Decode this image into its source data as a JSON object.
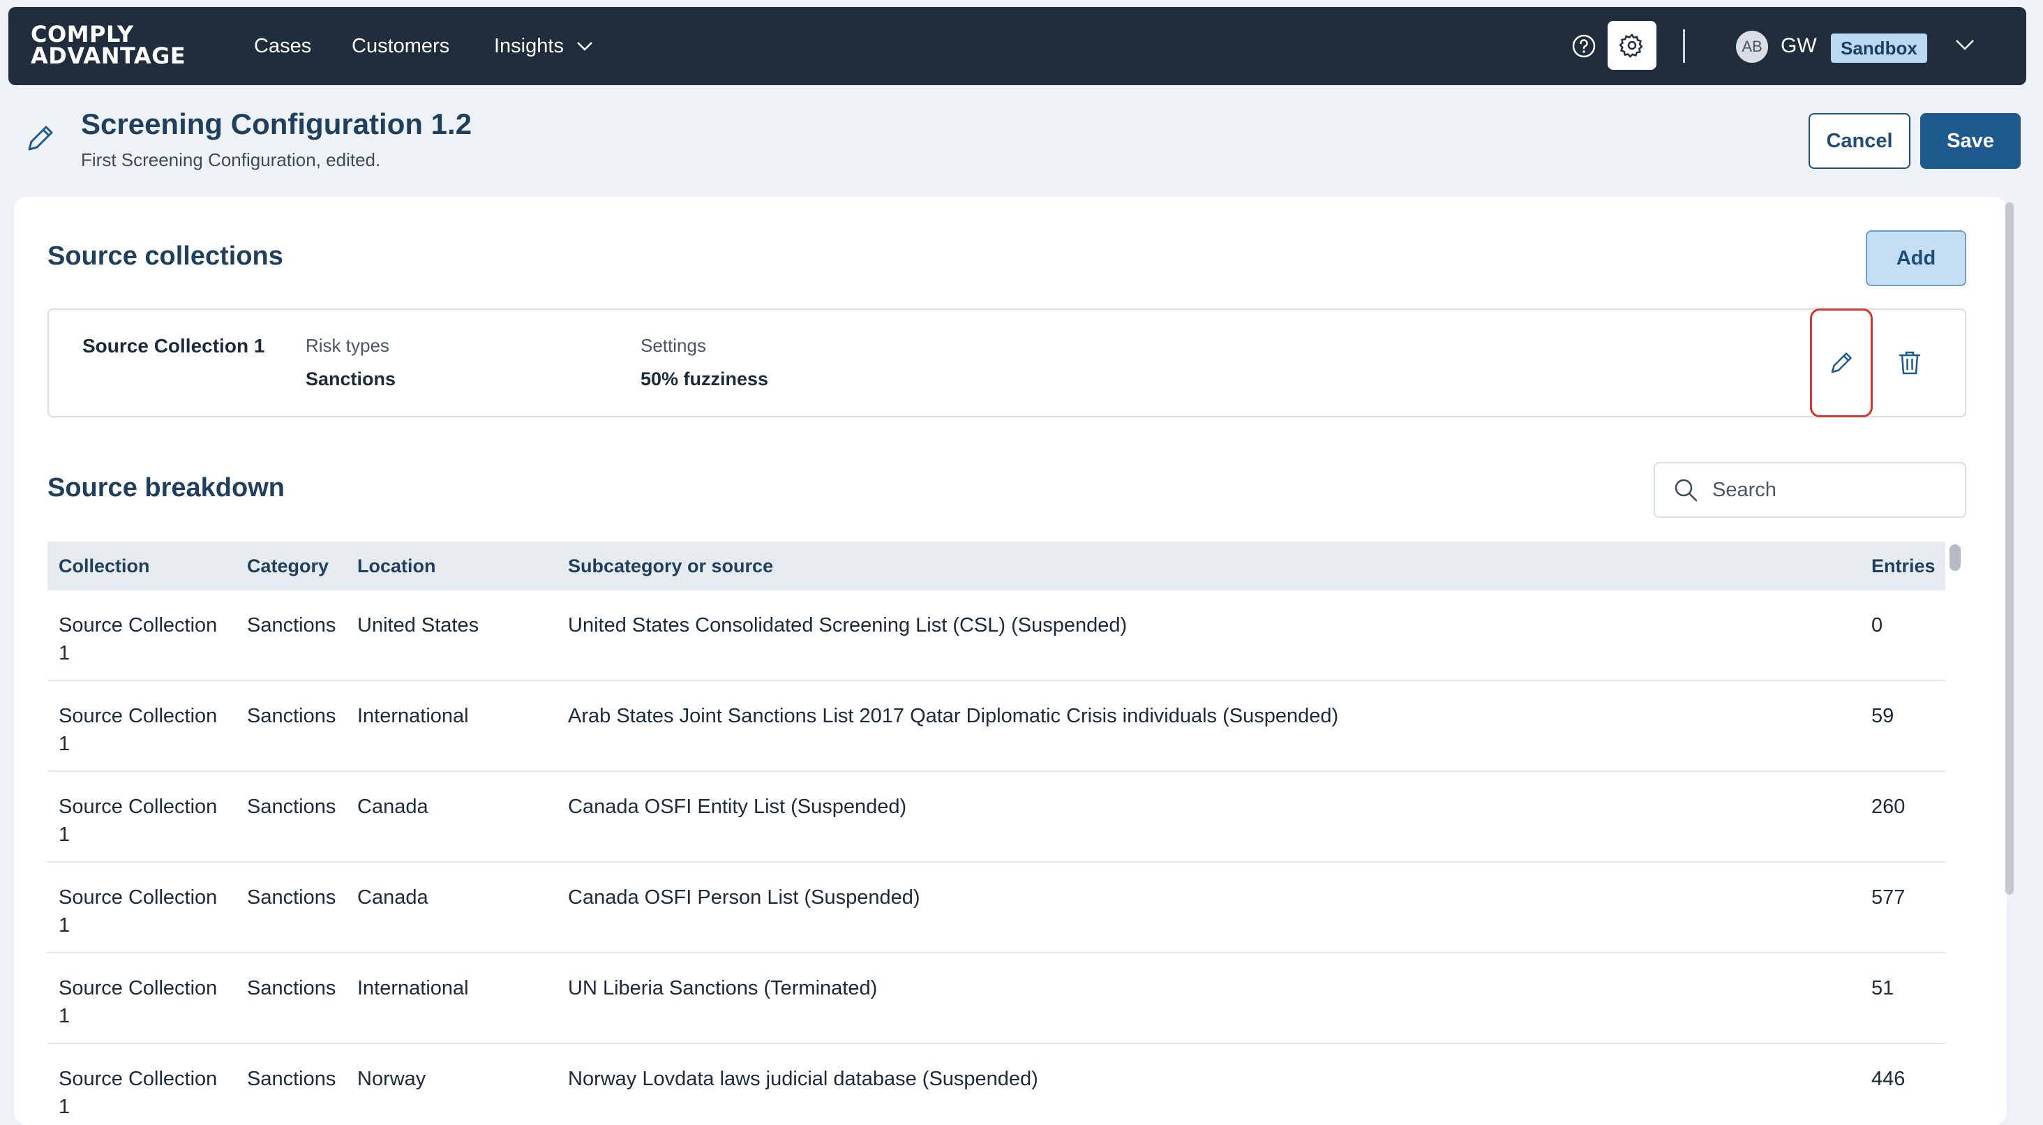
{
  "app": {
    "logo_line1": "COMPLY",
    "logo_line2": "ADVANTAGE"
  },
  "nav": {
    "cases": "Cases",
    "customers": "Customers",
    "insights": "Insights",
    "user_avatar": "AB",
    "user_initials": "GW",
    "environment": "Sandbox",
    "icons": [
      "help-icon",
      "gear-icon",
      "chevron-down-icon"
    ]
  },
  "header": {
    "title": "Screening Configuration 1.2",
    "subtitle": "First Screening Configuration, edited.",
    "cancel_label": "Cancel",
    "save_label": "Save"
  },
  "source_collections": {
    "title": "Source collections",
    "add_label": "Add",
    "items": [
      {
        "name": "Source Collection 1",
        "risk_types_label": "Risk types",
        "risk_types_value": "Sanctions",
        "settings_label": "Settings",
        "settings_value": "50% fuzziness"
      }
    ]
  },
  "source_breakdown": {
    "title": "Source breakdown",
    "search_placeholder": "Search",
    "columns": {
      "collection": "Collection",
      "category": "Category",
      "location": "Location",
      "subcategory": "Subcategory or source",
      "entries": "Entries"
    },
    "rows": [
      {
        "collection": "Source Collection 1",
        "category": "Sanctions",
        "location": "United States",
        "subcategory": "United States Consolidated Screening List (CSL) (Suspended)",
        "entries": "0"
      },
      {
        "collection": "Source Collection 1",
        "category": "Sanctions",
        "location": "International",
        "subcategory": "Arab States Joint Sanctions List 2017 Qatar Diplomatic Crisis individuals (Suspended)",
        "entries": "59"
      },
      {
        "collection": "Source Collection 1",
        "category": "Sanctions",
        "location": "Canada",
        "subcategory": "Canada OSFI Entity List (Suspended)",
        "entries": "260"
      },
      {
        "collection": "Source Collection 1",
        "category": "Sanctions",
        "location": "Canada",
        "subcategory": "Canada OSFI Person List (Suspended)",
        "entries": "577"
      },
      {
        "collection": "Source Collection 1",
        "category": "Sanctions",
        "location": "International",
        "subcategory": "UN Liberia Sanctions (Terminated)",
        "entries": "51"
      },
      {
        "collection": "Source Collection 1",
        "category": "Sanctions",
        "location": "Norway",
        "subcategory": "Norway Lovdata laws judicial database (Suspended)",
        "entries": "446"
      }
    ]
  },
  "colors": {
    "nav_bg": "#1f2d3d",
    "primary": "#1f5a8e",
    "highlight": "#d8362b",
    "badge_bg": "#b9d8f2"
  }
}
